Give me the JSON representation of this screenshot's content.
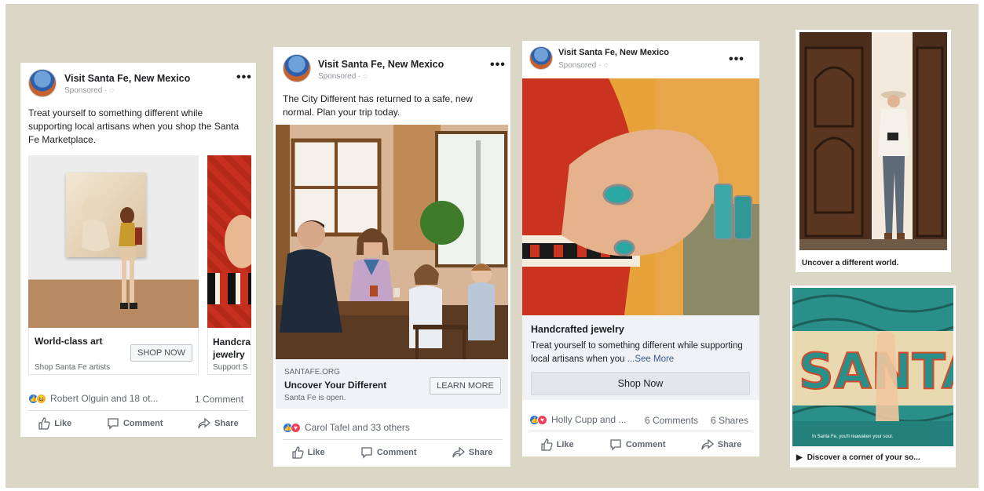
{
  "card1": {
    "page_name": "Visit Santa Fe, New Mexico",
    "sponsored": "Sponsored · ◌",
    "post_text": "Treat yourself to something different while supporting local artisans when you shop the Santa Fe Marketplace.",
    "carousel": [
      {
        "headline": "World-class art",
        "description": "Shop Santa Fe artists",
        "cta": "SHOP NOW"
      },
      {
        "headline": "Handcra\njewelry",
        "description": "Support S"
      }
    ],
    "reactions_text": "Robert Olguin and 18 ot...",
    "comments": "1 Comment",
    "actions": [
      "Like",
      "Comment",
      "Share"
    ]
  },
  "card2": {
    "page_name": "Visit Santa Fe, New Mexico",
    "sponsored": "Sponsored · ◌",
    "post_text": "The City Different has returned to a safe, new normal. Plan your trip today.",
    "link_domain": "SANTAFE.ORG",
    "link_title": "Uncover Your Different",
    "link_desc": "Santa Fe is open.",
    "cta": "LEARN MORE",
    "reactions_text": "Carol Tafel and 33 others",
    "actions": [
      "Like",
      "Comment",
      "Share"
    ]
  },
  "card3": {
    "page_name": "Visit Santa Fe, New Mexico",
    "sponsored": "Sponsored · ◌",
    "headline": "Handcrafted jewelry",
    "body": "Treat yourself to something different while supporting local artisans when you",
    "see_more": "...See More",
    "cta": "Shop Now",
    "reactions_text": "Holly Cupp and ...",
    "comments": "6 Comments",
    "shares": "6 Shares",
    "actions": [
      "Like",
      "Comment",
      "Share"
    ]
  },
  "story1": {
    "caption": "Uncover a different world."
  },
  "story2": {
    "caption": "Discover a corner of your so...",
    "overlay_text": "In Santa Fe, you'll reawaken your soul.",
    "mural_text": "SANTA"
  },
  "colors": {
    "background": "#dcd6c6",
    "like_blue": "#1877f2",
    "love_red": "#f33e58"
  }
}
